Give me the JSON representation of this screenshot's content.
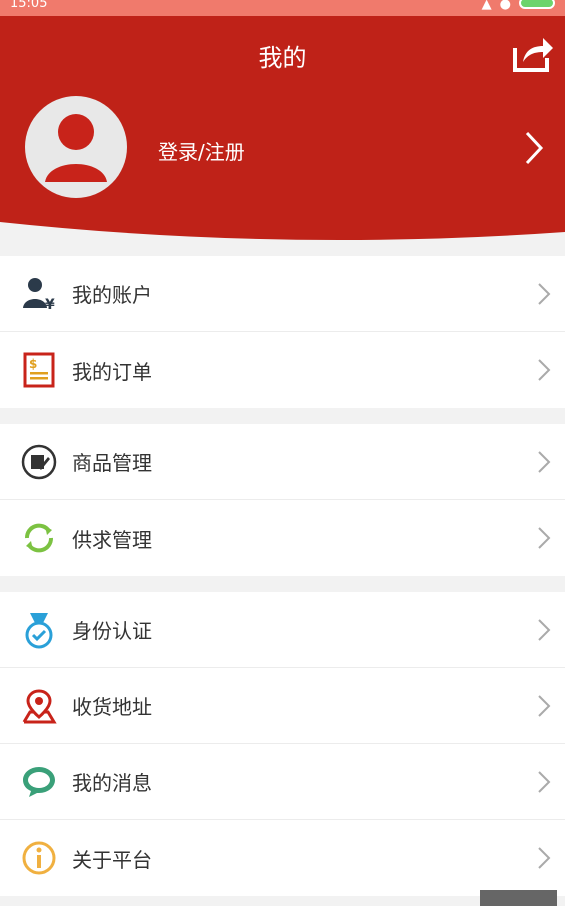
{
  "status_bar": {
    "time": "15:05"
  },
  "header": {
    "title": "我的",
    "login_label": "登录/注册",
    "background_color": "#bf2218"
  },
  "menu": {
    "groups": [
      {
        "items": [
          {
            "label": "我的账户",
            "icon": "account-yen-icon"
          },
          {
            "label": "我的订单",
            "icon": "order-document-icon"
          }
        ]
      },
      {
        "items": [
          {
            "label": "商品管理",
            "icon": "goods-edit-icon"
          },
          {
            "label": "供求管理",
            "icon": "supply-refresh-icon"
          }
        ]
      },
      {
        "items": [
          {
            "label": "身份认证",
            "icon": "medal-check-icon"
          },
          {
            "label": "收货地址",
            "icon": "location-pin-icon"
          },
          {
            "label": "我的消息",
            "icon": "message-bubble-icon"
          },
          {
            "label": "关于平台",
            "icon": "info-icon"
          }
        ]
      }
    ]
  }
}
